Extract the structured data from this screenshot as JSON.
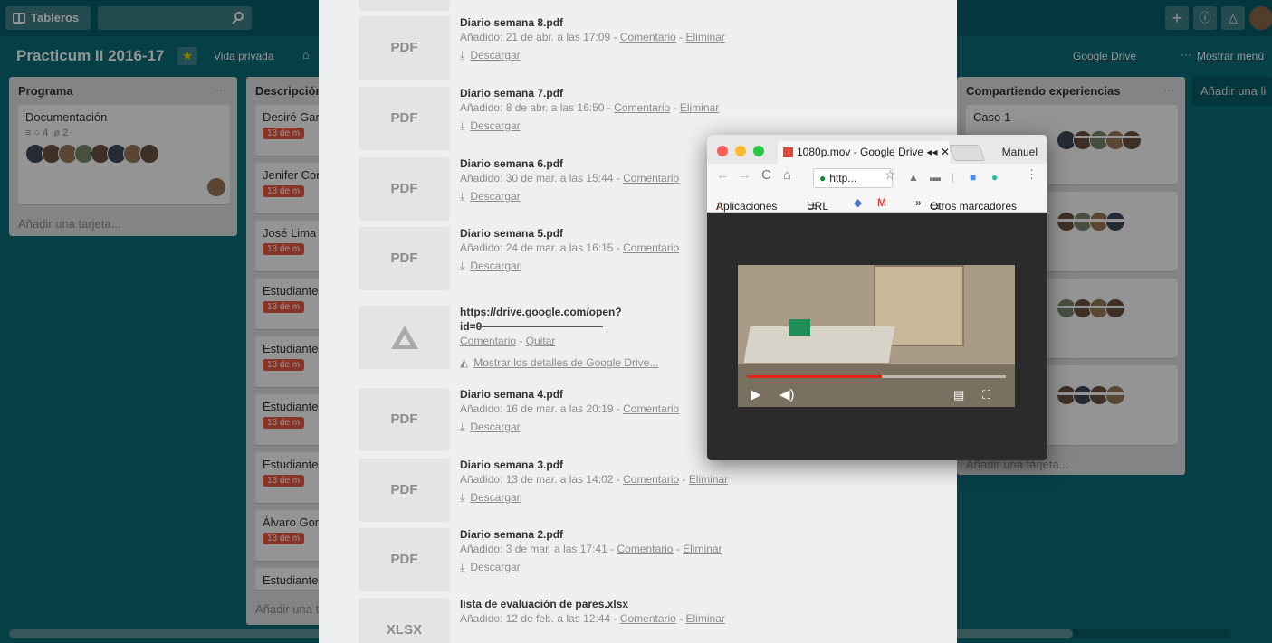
{
  "topbar": {
    "boards_label": "Tableros",
    "add": "+",
    "info": "i",
    "bell": "🔔"
  },
  "board": {
    "title": "Practicum II 2016-17",
    "privacy": "Vida privada",
    "drive_link": "Google Drive",
    "menu_link": "Mostrar menú",
    "dots": "···"
  },
  "lists": {
    "programa": {
      "title": "Programa",
      "card_title": "Documentación",
      "comments": "4",
      "attachments": "2",
      "add": "Añadir una tarjeta..."
    },
    "descripcion": {
      "title": "Descripción",
      "cards": [
        "Desiré Gar",
        "Jenifer Cor",
        "José Lima",
        "Estudiante",
        "Estudiante",
        "Estudiante",
        "Estudiante",
        "Álvaro Gon",
        "Estudiante"
      ],
      "due": "13 de m",
      "add": "Añadir una t"
    },
    "compartiendo": {
      "title": "Compartiendo experiencias",
      "card1": "Caso 1",
      "add": "Añadir una tarjeta..."
    },
    "add_list": "Añadir una li"
  },
  "attachments": [
    {
      "thumb": "PDF",
      "name": "Diario semana 8.pdf",
      "added": "Añadido: 21 de abr. a las 17:09",
      "comment": "Comentario",
      "remove": "Eliminar",
      "download": "Descargar"
    },
    {
      "thumb": "PDF",
      "name": "Diario semana 7.pdf",
      "added": "Añadido: 8 de abr. a las 16:50",
      "comment": "Comentario",
      "remove": "Eliminar",
      "download": "Descargar"
    },
    {
      "thumb": "PDF",
      "name": "Diario semana 6.pdf",
      "added": "Añadido: 30 de mar. a las 15:44",
      "comment": "Comentario",
      "download": "Descargar"
    },
    {
      "thumb": "PDF",
      "name": "Diario semana 5.pdf",
      "added": "Añadido: 24 de mar. a las 16:15",
      "comment": "Comentario",
      "download": "Descargar"
    },
    {
      "name": "https://drive.google.com/open?",
      "name2": "id=0",
      "comment": "Comentario",
      "remove": "Quitar",
      "details": "Mostrar los detalles de Google Drive..."
    },
    {
      "thumb": "PDF",
      "name": "Diario semana 4.pdf",
      "added": "Añadido: 16 de mar. a las 20:19",
      "comment": "Comentario",
      "download": "Descargar"
    },
    {
      "thumb": "PDF",
      "name": "Diario semana 3.pdf",
      "added": "Añadido: 13 de mar. a las 14:02",
      "comment": "Comentario",
      "remove": "Eliminar",
      "download": "Descargar"
    },
    {
      "thumb": "PDF",
      "name": "Diario semana 2.pdf",
      "added": "Añadido: 3 de mar. a las 17:41",
      "comment": "Comentario",
      "remove": "Eliminar",
      "download": "Descargar"
    },
    {
      "thumb": "XLSX",
      "name": "lista de evaluación de pares.xlsx",
      "added": "Añadido: 12 de feb. a las 12:44",
      "comment": "Comentario",
      "remove": "Eliminar"
    }
  ],
  "chrome": {
    "tab_title": "1080p.mov - Google Drive",
    "user": "Manuel",
    "omnibox": "http...",
    "bookmarks": {
      "apps": "Aplicaciones",
      "url": "URL",
      "more": "»",
      "others": "Otros marcadores"
    }
  },
  "video": {
    "progress": 0.52
  },
  "colors": {
    "board_bg": "#0a6e79",
    "due_red": "#eb5a46",
    "progress_red": "#e62117"
  }
}
